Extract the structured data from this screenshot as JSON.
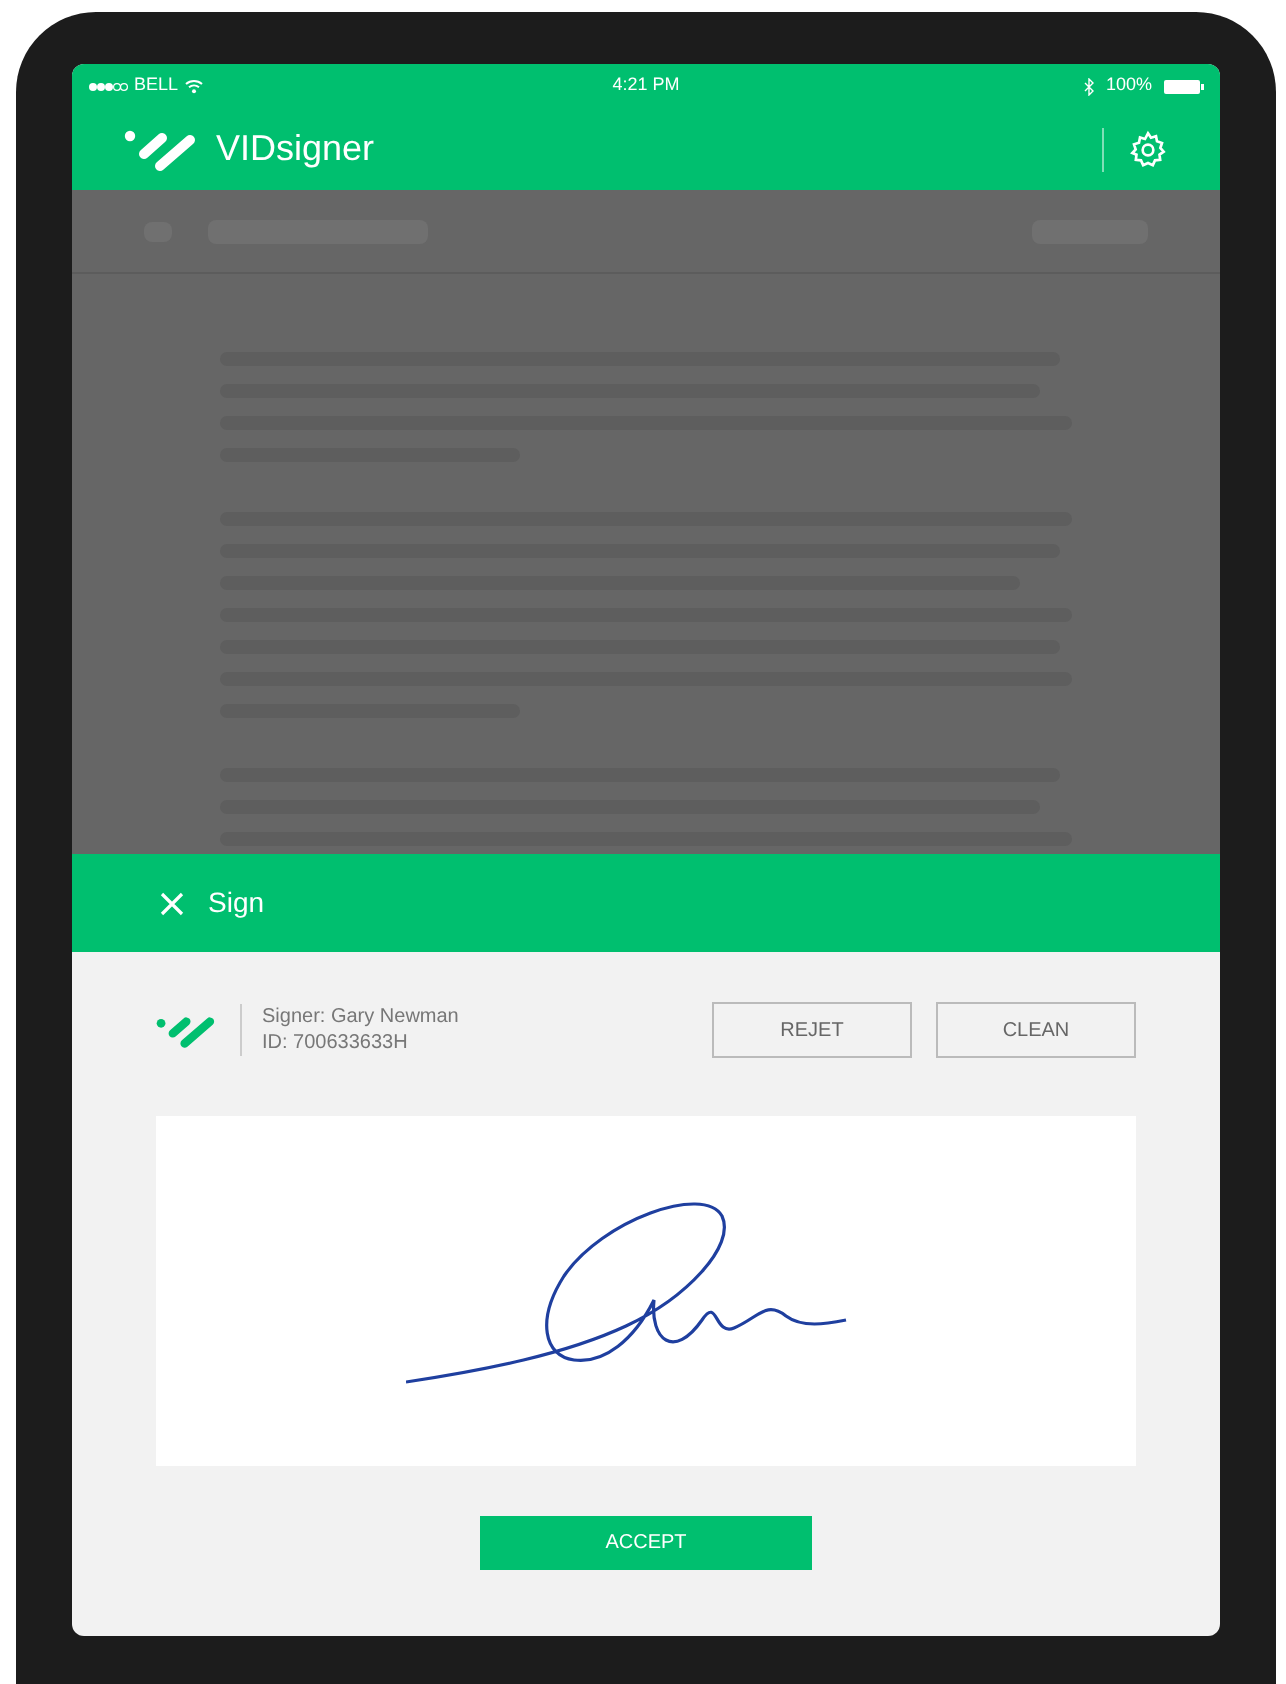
{
  "status_bar": {
    "carrier": "BELL",
    "time": "4:21 PM",
    "battery": "100%"
  },
  "app_bar": {
    "title": "VIDsigner"
  },
  "sign_panel": {
    "title": "Sign",
    "signer": "Signer: Gary Newman",
    "id": "ID: 700633633H",
    "buttons": [
      "REJET",
      "CLEAN"
    ],
    "accept": "ACCEPT"
  }
}
